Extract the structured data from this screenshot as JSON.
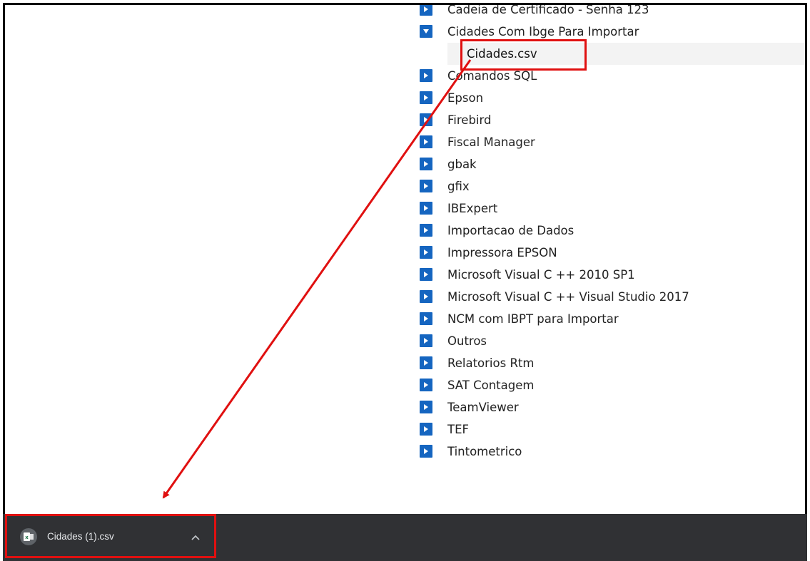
{
  "tree": {
    "items": [
      {
        "label": "Cadeia de Certificado - Senha 123",
        "state": "collapsed"
      },
      {
        "label": "Cidades Com Ibge Para Importar",
        "state": "expanded",
        "children": [
          {
            "label": "Cidades.csv"
          }
        ]
      },
      {
        "label": "Comandos SQL",
        "state": "collapsed"
      },
      {
        "label": "Epson",
        "state": "collapsed"
      },
      {
        "label": "Firebird",
        "state": "collapsed"
      },
      {
        "label": "Fiscal Manager",
        "state": "collapsed"
      },
      {
        "label": "gbak",
        "state": "collapsed"
      },
      {
        "label": "gfix",
        "state": "collapsed"
      },
      {
        "label": "IBExpert",
        "state": "collapsed"
      },
      {
        "label": "Importacao de Dados",
        "state": "collapsed"
      },
      {
        "label": "Impressora EPSON",
        "state": "collapsed"
      },
      {
        "label": "Microsoft Visual C ++ 2010 SP1",
        "state": "collapsed"
      },
      {
        "label": "Microsoft Visual C ++ Visual Studio 2017",
        "state": "collapsed"
      },
      {
        "label": "NCM com IBPT para Importar",
        "state": "collapsed"
      },
      {
        "label": "Outros",
        "state": "collapsed"
      },
      {
        "label": "Relatorios Rtm",
        "state": "collapsed"
      },
      {
        "label": "SAT Contagem",
        "state": "collapsed"
      },
      {
        "label": "TeamViewer",
        "state": "collapsed"
      },
      {
        "label": "TEF",
        "state": "collapsed"
      },
      {
        "label": "Tintometrico",
        "state": "collapsed"
      }
    ]
  },
  "download_bar": {
    "item": {
      "file_name": "Cidades (1).csv",
      "icon": "excel-file-icon"
    },
    "chevron_icon": "chevron-up-icon"
  },
  "annotation": {
    "color": "#e01010"
  },
  "colors": {
    "toggle": "#1565c0",
    "bar": "#303134"
  }
}
